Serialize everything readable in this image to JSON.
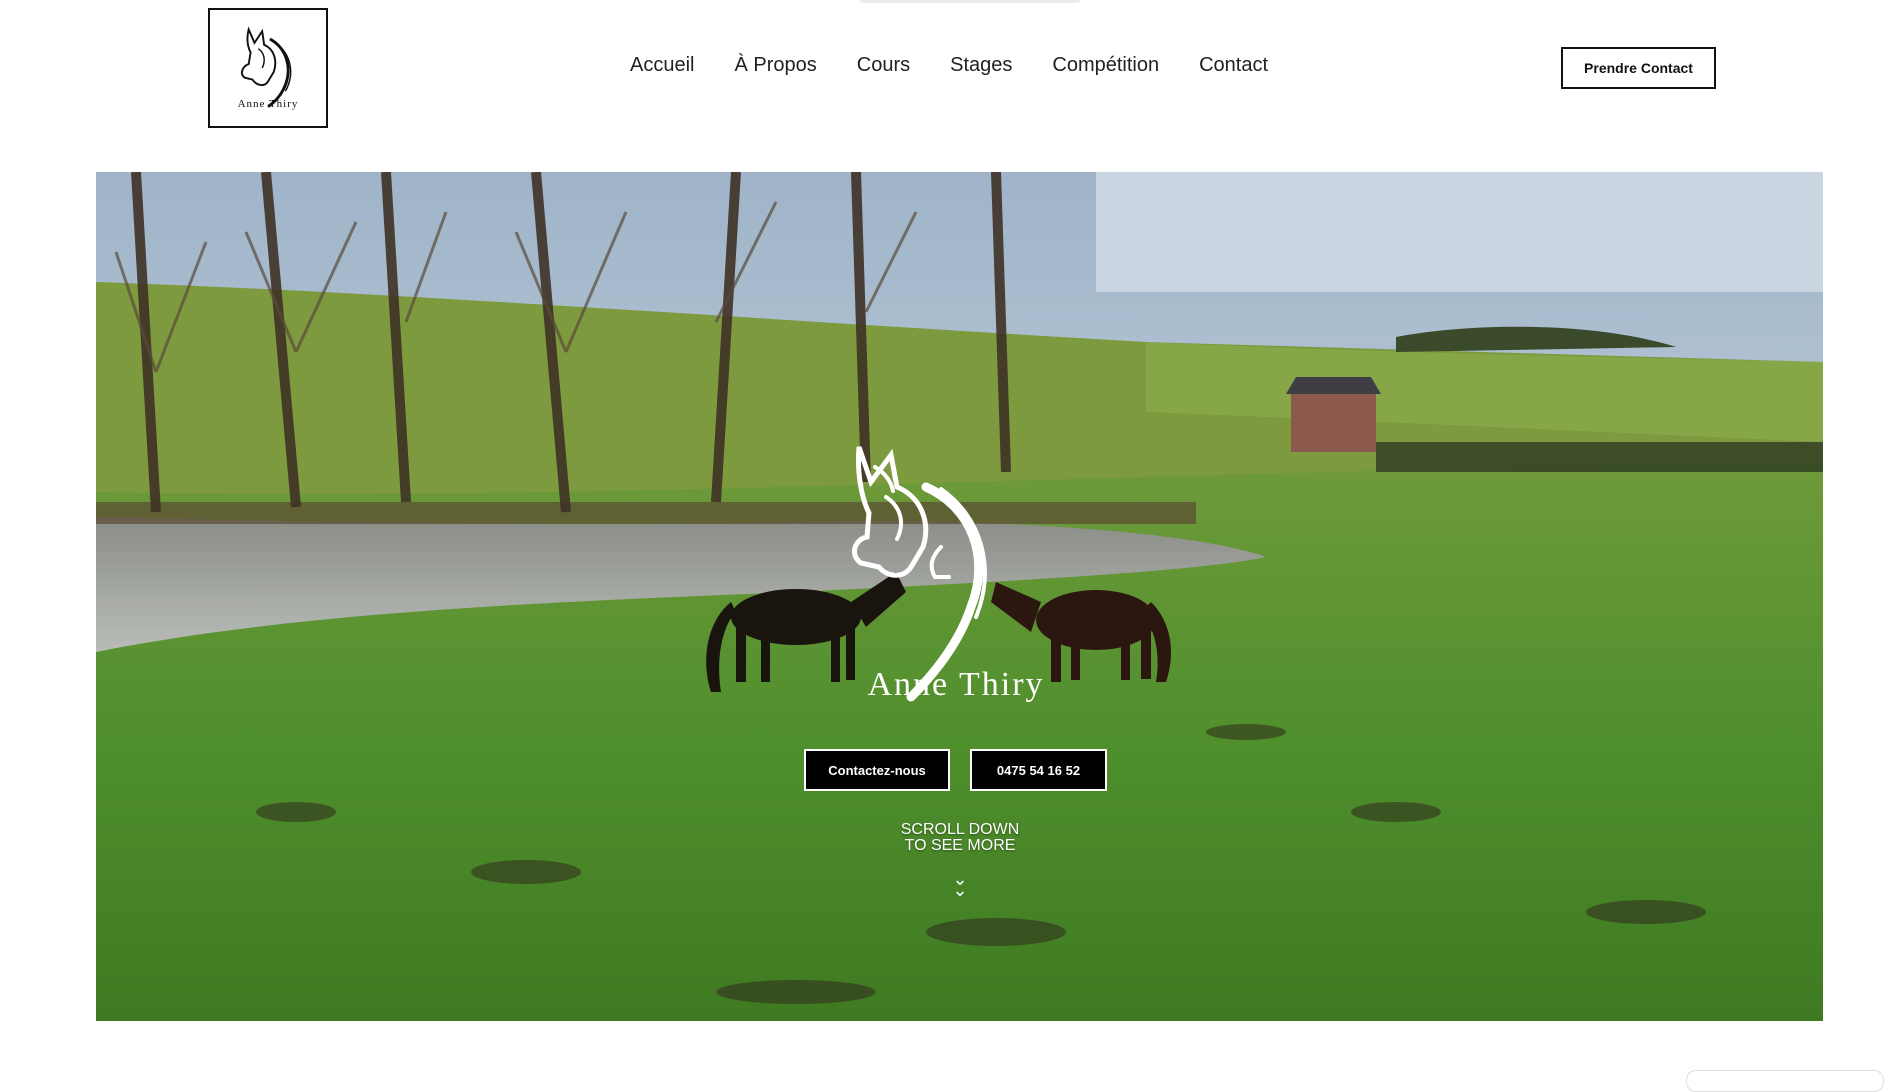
{
  "header": {
    "logo_text": "Anne Thiry",
    "nav": [
      "Accueil",
      "À Propos",
      "Cours",
      "Stages",
      "Compétition",
      "Contact"
    ],
    "cta_label": "Prendre Contact"
  },
  "hero": {
    "logo_text": "Anne Thiry",
    "contact_button": "Contactez-nous",
    "phone_button": "0475 54 16 52",
    "scroll_line1": "SCROLL DOWN",
    "scroll_line2": "TO SEE MORE",
    "scroll_icon": "double-chevron-down-icon"
  },
  "colors": {
    "accent": "#000000",
    "grass": "#4f8f2c",
    "sky": "#b8cbe0"
  }
}
